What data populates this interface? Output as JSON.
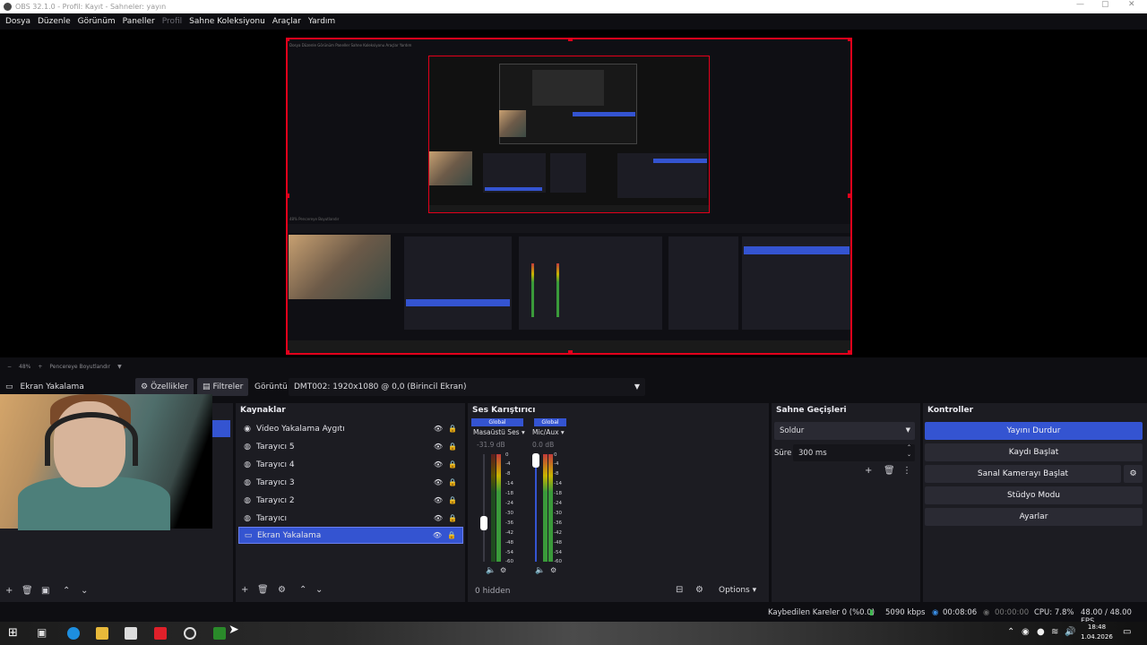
{
  "window": {
    "title": "OBS 32.1.0 - Profil: Kayıt - Sahneler: yayın"
  },
  "menu": [
    "Dosya",
    "Düzenle",
    "Görünüm",
    "Paneller",
    "Profil",
    "Sahne Koleksiyonu",
    "Araçlar",
    "Yardım"
  ],
  "zoom": {
    "percent": "48%",
    "fit_label": "Pencereye Boyutlandır"
  },
  "propbar": {
    "source_name": "Ekran Yakalama",
    "properties_label": "Özellikler",
    "filters_label": "Filtreler",
    "display_label": "Görüntü",
    "display_value": "DMT002: 1920x1080 @ 0,0 (Birincil Ekran)"
  },
  "sources": {
    "title": "Kaynaklar",
    "items": [
      {
        "label": "Video Yakalama Aygıtı",
        "icon": "camera-icon"
      },
      {
        "label": "Tarayıcı 5",
        "icon": "globe-icon"
      },
      {
        "label": "Tarayıcı 4",
        "icon": "globe-icon"
      },
      {
        "label": "Tarayıcı 3",
        "icon": "globe-icon"
      },
      {
        "label": "Tarayıcı 2",
        "icon": "globe-icon"
      },
      {
        "label": "Tarayıcı",
        "icon": "globe-icon"
      },
      {
        "label": "Ekran Yakalama",
        "icon": "monitor-icon",
        "selected": true
      }
    ]
  },
  "mixer": {
    "title": "Ses Karıştırıcı",
    "channels": [
      {
        "global": "Global",
        "name": "Masaüstü Ses",
        "db": "-31.9 dB"
      },
      {
        "global": "Global",
        "name": "Mic/Aux",
        "db": "0.0 dB"
      }
    ],
    "ticks": [
      "0",
      "-4",
      "-8",
      "-14",
      "-18",
      "-24",
      "-30",
      "-36",
      "-42",
      "-48",
      "-54",
      "-60"
    ],
    "hidden_label": "0 hidden",
    "options_label": "Options"
  },
  "transitions": {
    "title": "Sahne Geçişleri",
    "type": "Soldur",
    "duration_label": "Süre",
    "duration_value": "300 ms"
  },
  "controls": {
    "title": "Kontroller",
    "stop_stream": "Yayını Durdur",
    "start_record": "Kaydı Başlat",
    "virtual_cam": "Sanal Kamerayı Başlat",
    "studio_mode": "Stüdyo Modu",
    "settings": "Ayarlar"
  },
  "status": {
    "dropped_frames": "Kaybedilen Kareler 0 (%0.0)",
    "bitrate": "5090 kbps",
    "stream_time": "00:08:06",
    "record_time": "00:00:00",
    "cpu": "CPU: 7.8%",
    "fps": "48.00 / 48.00 FPS"
  },
  "clock": {
    "time": "18:48",
    "date": "1.04.2026"
  }
}
